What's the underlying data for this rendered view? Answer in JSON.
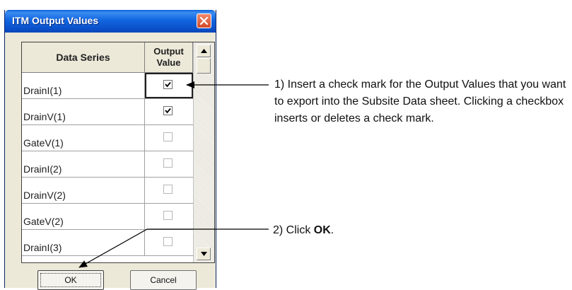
{
  "dialog": {
    "title": "ITM Output Values",
    "close_icon": "close-x-icon"
  },
  "grid": {
    "headers": {
      "series": "Data Series",
      "output_line1": "Output",
      "output_line2": "Value"
    },
    "rows": [
      {
        "name": "DrainI(1)",
        "checked": true,
        "enabled": true,
        "selected": true
      },
      {
        "name": "DrainV(1)",
        "checked": true,
        "enabled": true,
        "selected": false
      },
      {
        "name": "GateV(1)",
        "checked": false,
        "enabled": false,
        "selected": false
      },
      {
        "name": "DrainI(2)",
        "checked": false,
        "enabled": false,
        "selected": false
      },
      {
        "name": "DrainV(2)",
        "checked": false,
        "enabled": false,
        "selected": false
      },
      {
        "name": "GateV(2)",
        "checked": false,
        "enabled": false,
        "selected": false
      },
      {
        "name": "DrainI(3)",
        "checked": false,
        "enabled": false,
        "selected": false
      }
    ]
  },
  "buttons": {
    "ok": "OK",
    "cancel": "Cancel"
  },
  "annotations": {
    "step1": "1) Insert a check mark for the Output Values that you want to export into the Subsite Data sheet. Clicking a checkbox inserts or deletes a check mark.",
    "step2_prefix": "2) Click ",
    "step2_bold": "OK",
    "step2_suffix": "."
  },
  "colors": {
    "titlebar": "#0a5fd8",
    "dialog_bg": "#ece9d8",
    "close_button": "#d2492a"
  }
}
